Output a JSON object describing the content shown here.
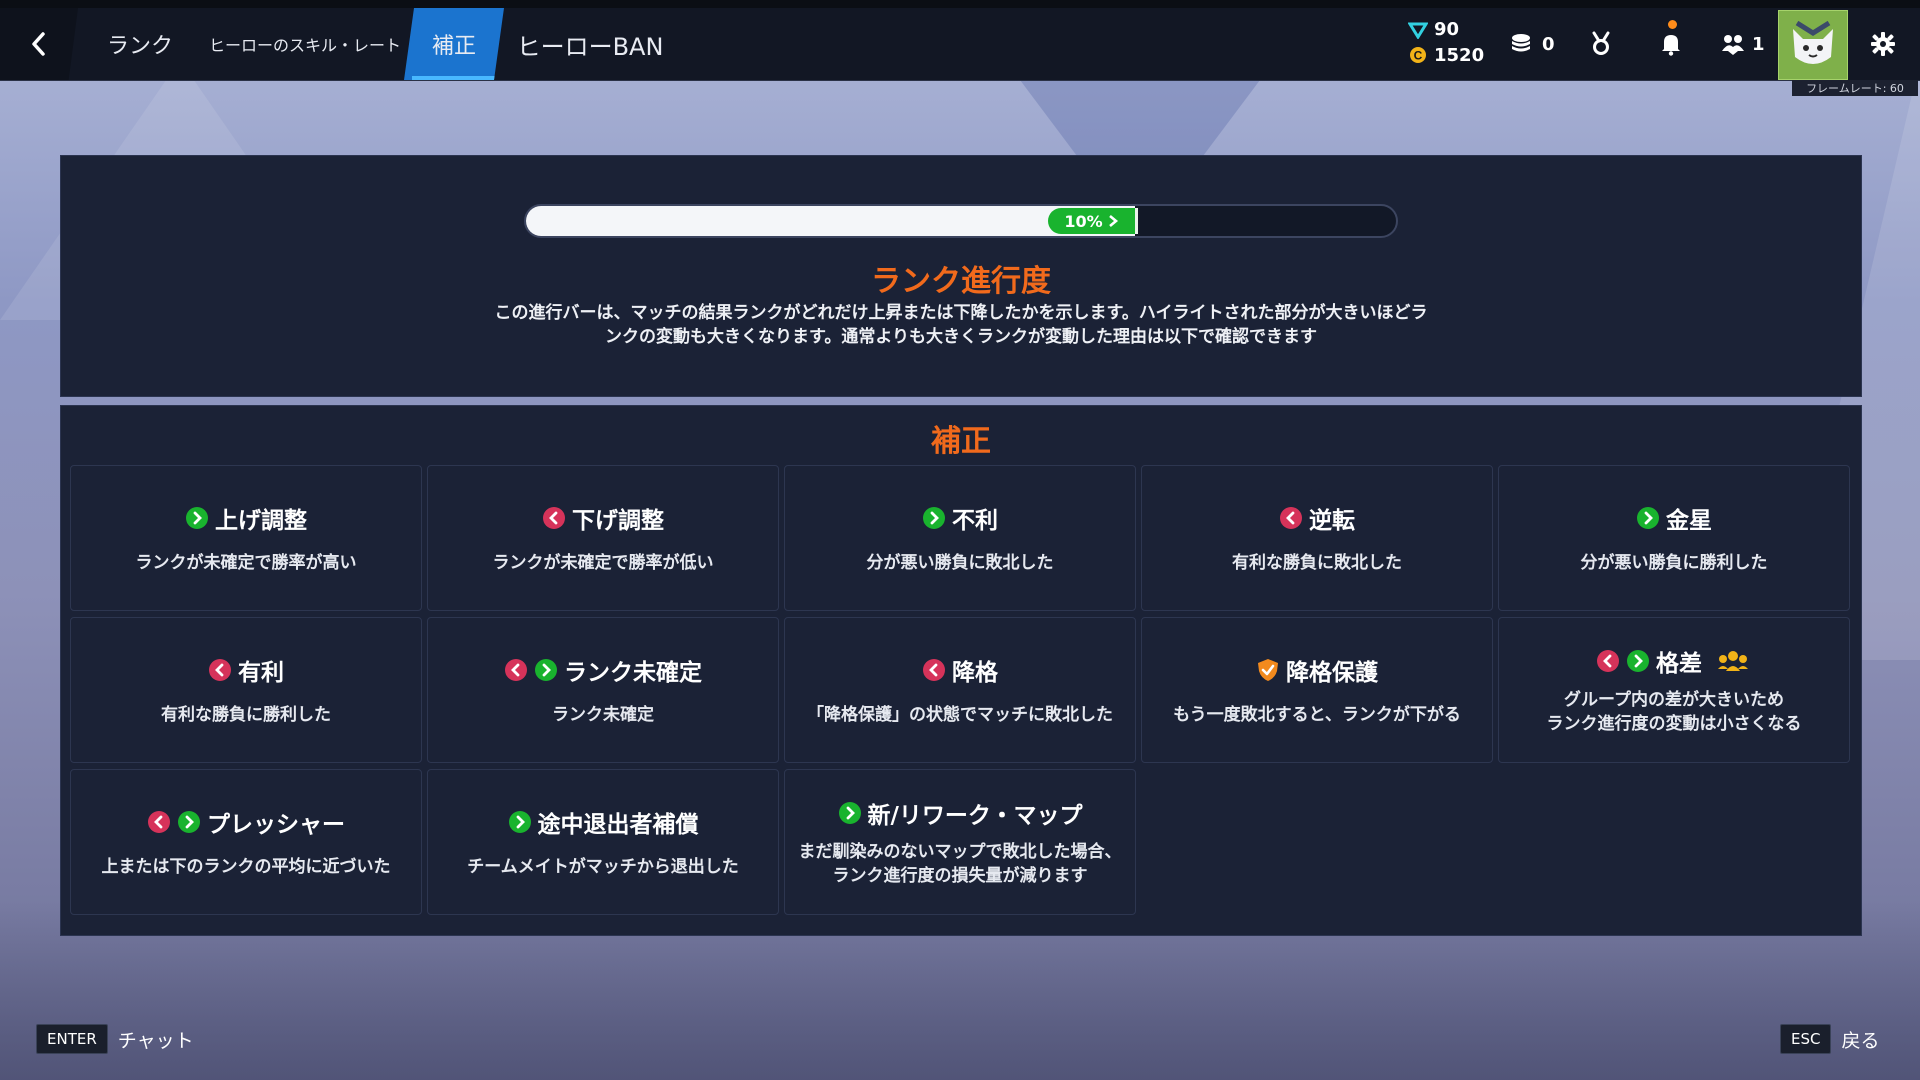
{
  "header": {
    "tabs": [
      {
        "label": "ランク"
      },
      {
        "label": "ヒーローのスキル・レート"
      },
      {
        "label": "補正"
      },
      {
        "label": "ヒーローBAN"
      }
    ],
    "currency": {
      "gems": "90",
      "coins": "1520"
    },
    "tokens": "0",
    "friends": "1",
    "framerate": "フレームレート: 60",
    "accent": "#1b74cf"
  },
  "progress": {
    "value": 0.7,
    "delta_label": "10%",
    "title": "ランク進行度",
    "description_line1": "この進行バーは、マッチの結果ランクがどれだけ上昇または下降したかを示します。ハイライトされた部分が大きいほどラ",
    "description_line2": "ンクの変動も大きくなります。通常よりも大きくランクが変動した理由は以下で確認できます"
  },
  "hosei": {
    "title": "補正",
    "cards": [
      {
        "name": "上げ調整",
        "desc": "ランクが未確定で勝率が高い",
        "icons": [
          "up-icon"
        ]
      },
      {
        "name": "下げ調整",
        "desc": "ランクが未確定で勝率が低い",
        "icons": [
          "down-icon"
        ]
      },
      {
        "name": "不利",
        "desc": "分が悪い勝負に敗北した",
        "icons": [
          "up-icon"
        ]
      },
      {
        "name": "逆転",
        "desc": "有利な勝負に敗北した",
        "icons": [
          "down-icon"
        ]
      },
      {
        "name": "金星",
        "desc": "分が悪い勝負に勝利した",
        "icons": [
          "up-icon"
        ]
      },
      {
        "name": "有利",
        "desc": "有利な勝負に勝利した",
        "icons": [
          "down-icon"
        ]
      },
      {
        "name": "ランク未確定",
        "desc": "ランク未確定",
        "icons": [
          "down-icon",
          "up-icon"
        ]
      },
      {
        "name": "降格",
        "desc": "「降格保護」の状態でマッチに敗北した",
        "icons": [
          "down-icon"
        ]
      },
      {
        "name": "降格保護",
        "desc": "もう一度敗北すると、ランクが下がる",
        "icons": [
          "shield-icon"
        ]
      },
      {
        "name": "格差",
        "desc_line1": "グループ内の差が大きいため",
        "desc_line2": "ランク進行度の変動は小さくなる",
        "icons": [
          "down-icon",
          "up-icon",
          "group-icon"
        ]
      },
      {
        "name": "プレッシャー",
        "desc": "上または下のランクの平均に近づいた",
        "icons": [
          "down-icon",
          "up-icon"
        ]
      },
      {
        "name": "途中退出者補償",
        "desc": "チームメイトがマッチから退出した",
        "icons": [
          "up-icon"
        ]
      },
      {
        "name": "新/リワーク・マップ",
        "desc_line1": "まだ馴染みのないマップで敗北した場合、",
        "desc_line2": "ランク進行度の損失量が減ります",
        "icons": [
          "up-icon"
        ]
      }
    ]
  },
  "footer": {
    "enter_key": "ENTER",
    "enter_label": "チャット",
    "esc_key": "ESC",
    "esc_label": "戻る"
  },
  "colors": {
    "up": "#19b32e",
    "down": "#d6335a",
    "shield": "#f28a1e",
    "title_orange": "#f16a1c"
  }
}
